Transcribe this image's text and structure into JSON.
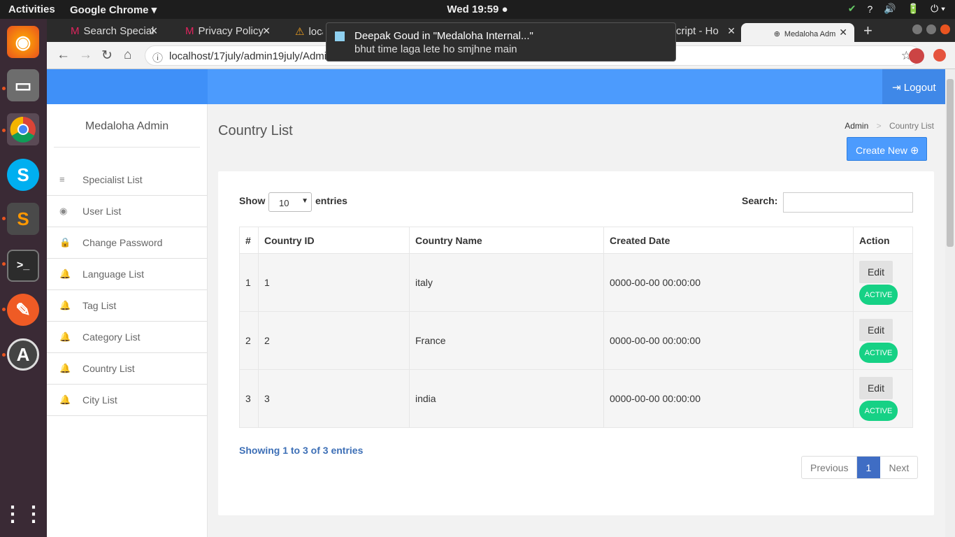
{
  "topbar": {
    "activities": "Activities",
    "app": "Google Chrome ▾",
    "clock": "Wed 19:59 ●",
    "tray": [
      "✔",
      "?",
      "🔊",
      "🔋",
      "⏻ ▾"
    ]
  },
  "dock": {
    "icons": [
      "firefox-icon",
      "files-icon",
      "chrome-icon",
      "skype-icon",
      "sublime-icon",
      "terminal-icon",
      "postman-icon",
      "software-updater-icon",
      "app-grid-icon"
    ]
  },
  "tabs": [
    {
      "label": "Search Special",
      "icon": "M"
    },
    {
      "label": "Privacy Policy",
      "icon": "M"
    },
    {
      "label": "loca",
      "icon": "⚠"
    },
    {
      "label": "cript - Ho",
      "icon": ""
    },
    {
      "label": "Medaloha Adm",
      "icon": "⊕"
    }
  ],
  "addressbar": {
    "url": "localhost/17july/admin19july/Admi"
  },
  "notification": {
    "title": "Deepak Goud in \"Medaloha Internal...\"",
    "body": "bhut time laga lete ho smjhne main"
  },
  "header": {
    "logout": "Logout"
  },
  "sidebar": {
    "brand": "Medaloha Admin",
    "items": [
      {
        "label": "Specialist List",
        "icon": "≡"
      },
      {
        "label": "User List",
        "icon": "◉"
      },
      {
        "label": "Change Password",
        "icon": "🔒"
      },
      {
        "label": "Language List",
        "icon": "🔔"
      },
      {
        "label": "Tag List",
        "icon": "🔔"
      },
      {
        "label": "Category List",
        "icon": "🔔"
      },
      {
        "label": "Country List",
        "icon": "🔔"
      },
      {
        "label": "City List",
        "icon": "🔔"
      }
    ]
  },
  "main": {
    "title": "Country List",
    "breadcrumb": {
      "root": "Admin",
      "sep": ">",
      "current": "Country List"
    },
    "create_label": "Create New",
    "show_label": "Show",
    "page_size": "10",
    "entries_label": "entries",
    "search_label": "Search:",
    "columns": [
      "#",
      "Country ID",
      "Country Name",
      "Created Date",
      "Action"
    ],
    "rows": [
      {
        "num": "1",
        "id": "1",
        "name": "italy",
        "date": "0000-00-00 00:00:00",
        "edit": "Edit",
        "status": "ACTIVE"
      },
      {
        "num": "2",
        "id": "2",
        "name": "France",
        "date": "0000-00-00 00:00:00",
        "edit": "Edit",
        "status": "ACTIVE"
      },
      {
        "num": "3",
        "id": "3",
        "name": "india",
        "date": "0000-00-00 00:00:00",
        "edit": "Edit",
        "status": "ACTIVE"
      }
    ],
    "info": "Showing 1 to 3 of 3 entries",
    "pager": {
      "prev": "Previous",
      "page": "1",
      "next": "Next"
    }
  }
}
